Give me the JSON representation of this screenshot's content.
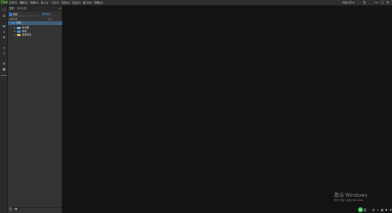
{
  "app": {
    "logo": "Dw"
  },
  "menubar": {
    "items": [
      "文件(F)",
      "编辑(E)",
      "查看(V)",
      "插入(I)",
      "工具(T)",
      "查找(D)",
      "站点(S)",
      "窗口(W)",
      "帮助(H)"
    ],
    "workspace": "开发人员 ▾",
    "controls": {
      "minimize": "—",
      "maximize": "□",
      "close": "✕"
    }
  },
  "files_panel": {
    "tabs": [
      "文件",
      "代码片断"
    ],
    "site": "桌面",
    "manage_sites": "管理站点",
    "columns": {
      "name": "本地文件",
      "size": "大小"
    },
    "tree": {
      "root": "桌面",
      "children": [
        "此电脑",
        "网络",
        "桌面项目"
      ]
    }
  },
  "watermark": {
    "title": "激活 Windows",
    "subtitle": "转到\"设置\"以激活 Windows。"
  },
  "tray": {
    "wechat": "微",
    "lang": "英"
  }
}
